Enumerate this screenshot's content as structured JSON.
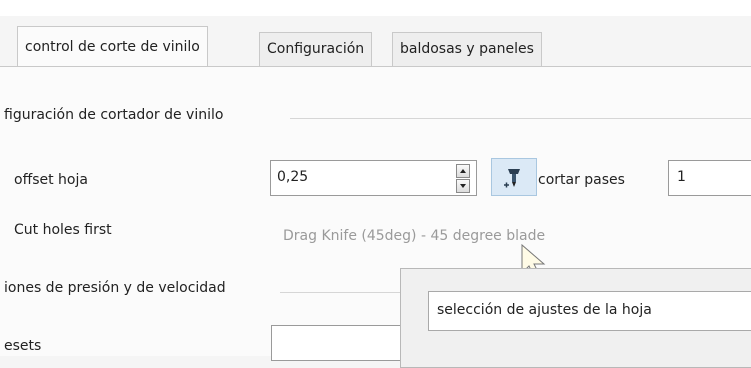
{
  "tabs": [
    {
      "label": "control de corte de vinilo",
      "active": true
    },
    {
      "label": "Configuración",
      "active": false
    },
    {
      "label": "baldosas y paneles",
      "active": false
    }
  ],
  "section_cutter": {
    "title": "figuración de cortador de vinilo"
  },
  "blade_offset": {
    "label": "offset hoja",
    "value": "0,25"
  },
  "cut_passes": {
    "label": "cortar pases",
    "value": "1"
  },
  "cut_holes": {
    "label": "Cut holes first"
  },
  "blade_hint": "Drag Knife (45deg) - 45 degree blade",
  "section_pressure": {
    "title": "iones de presión y de velocidad"
  },
  "presets": {
    "label": "esets",
    "value": ""
  },
  "popup": {
    "title": "selección de ajustes de la hoja"
  },
  "icons": {
    "knife_button": "drag-knife-icon"
  },
  "colors": {
    "accent_button_bg": "#dbe9f6",
    "hint_text": "#9a9a9a"
  }
}
